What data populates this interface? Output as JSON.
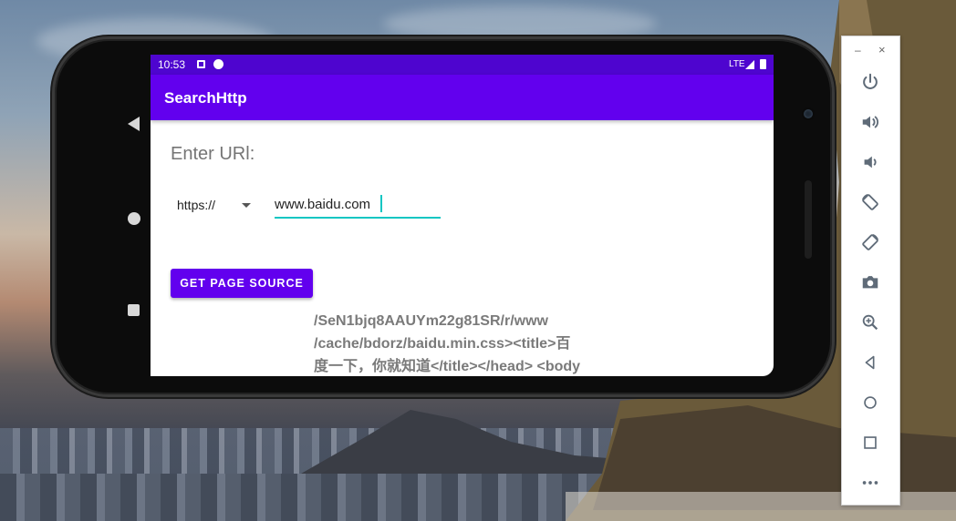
{
  "statusbar": {
    "time": "10:53",
    "network": "LTE"
  },
  "app": {
    "title": "SearchHttp"
  },
  "form": {
    "label": "Enter URl:",
    "protocol": "https://",
    "url_value": "www.baidu.com",
    "button_label": "GET PAGE SOURCE"
  },
  "source": {
    "lines": [
      "/SeN1bjq8AAUYm22g81SR/r/www",
      "/cache/bdorz/baidu.min.css><title>百",
      "度一下，你就知道</title></head> <body"
    ]
  },
  "toolbar": {
    "minimize": "–",
    "close": "×",
    "buttons": [
      "power-icon",
      "volume-up-icon",
      "volume-down-icon",
      "rotate-left-icon",
      "rotate-right-icon",
      "camera-icon",
      "zoom-icon",
      "back-icon",
      "home-icon",
      "overview-icon",
      "more-icon"
    ]
  },
  "colors": {
    "primary": "#6200ee",
    "status": "#4e05cf",
    "accent": "#0fc6c2"
  }
}
